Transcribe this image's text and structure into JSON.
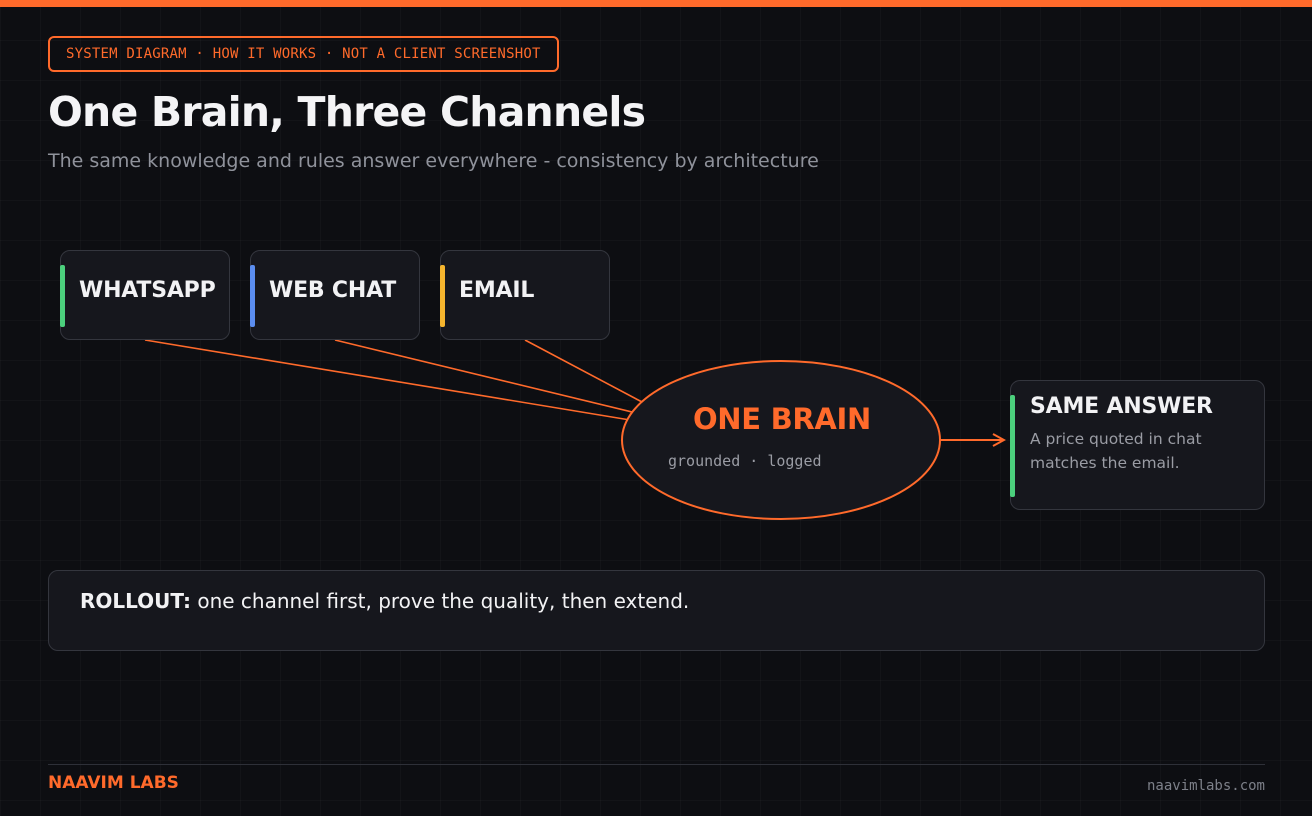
{
  "header": {
    "tag": "SYSTEM DIAGRAM · HOW IT WORKS · NOT A CLIENT SCREENSHOT",
    "title": "One Brain, Three Channels",
    "subtitle": "The same knowledge and rules answer everywhere - consistency by architecture"
  },
  "channels": [
    {
      "label": "WHATSAPP",
      "accent_color": "#4cd07d"
    },
    {
      "label": "WEB CHAT",
      "accent_color": "#5b8def"
    },
    {
      "label": "EMAIL",
      "accent_color": "#f5b52e"
    }
  ],
  "brain": {
    "title": "ONE BRAIN",
    "subtitle": "grounded · logged",
    "color": "#ff6a2b"
  },
  "answer": {
    "title": "SAME ANSWER",
    "description": "A price quoted in chat matches the email.",
    "accent_color": "#4cd07d"
  },
  "rollout": {
    "label": "ROLLOUT:",
    "text": " one channel first, prove the quality, then extend."
  },
  "footer": {
    "brand": "NAAVIM LABS",
    "site": "naavimlabs.com"
  },
  "colors": {
    "accent": "#ff6a2b",
    "background": "#0d0e12",
    "card": "#16171d"
  }
}
